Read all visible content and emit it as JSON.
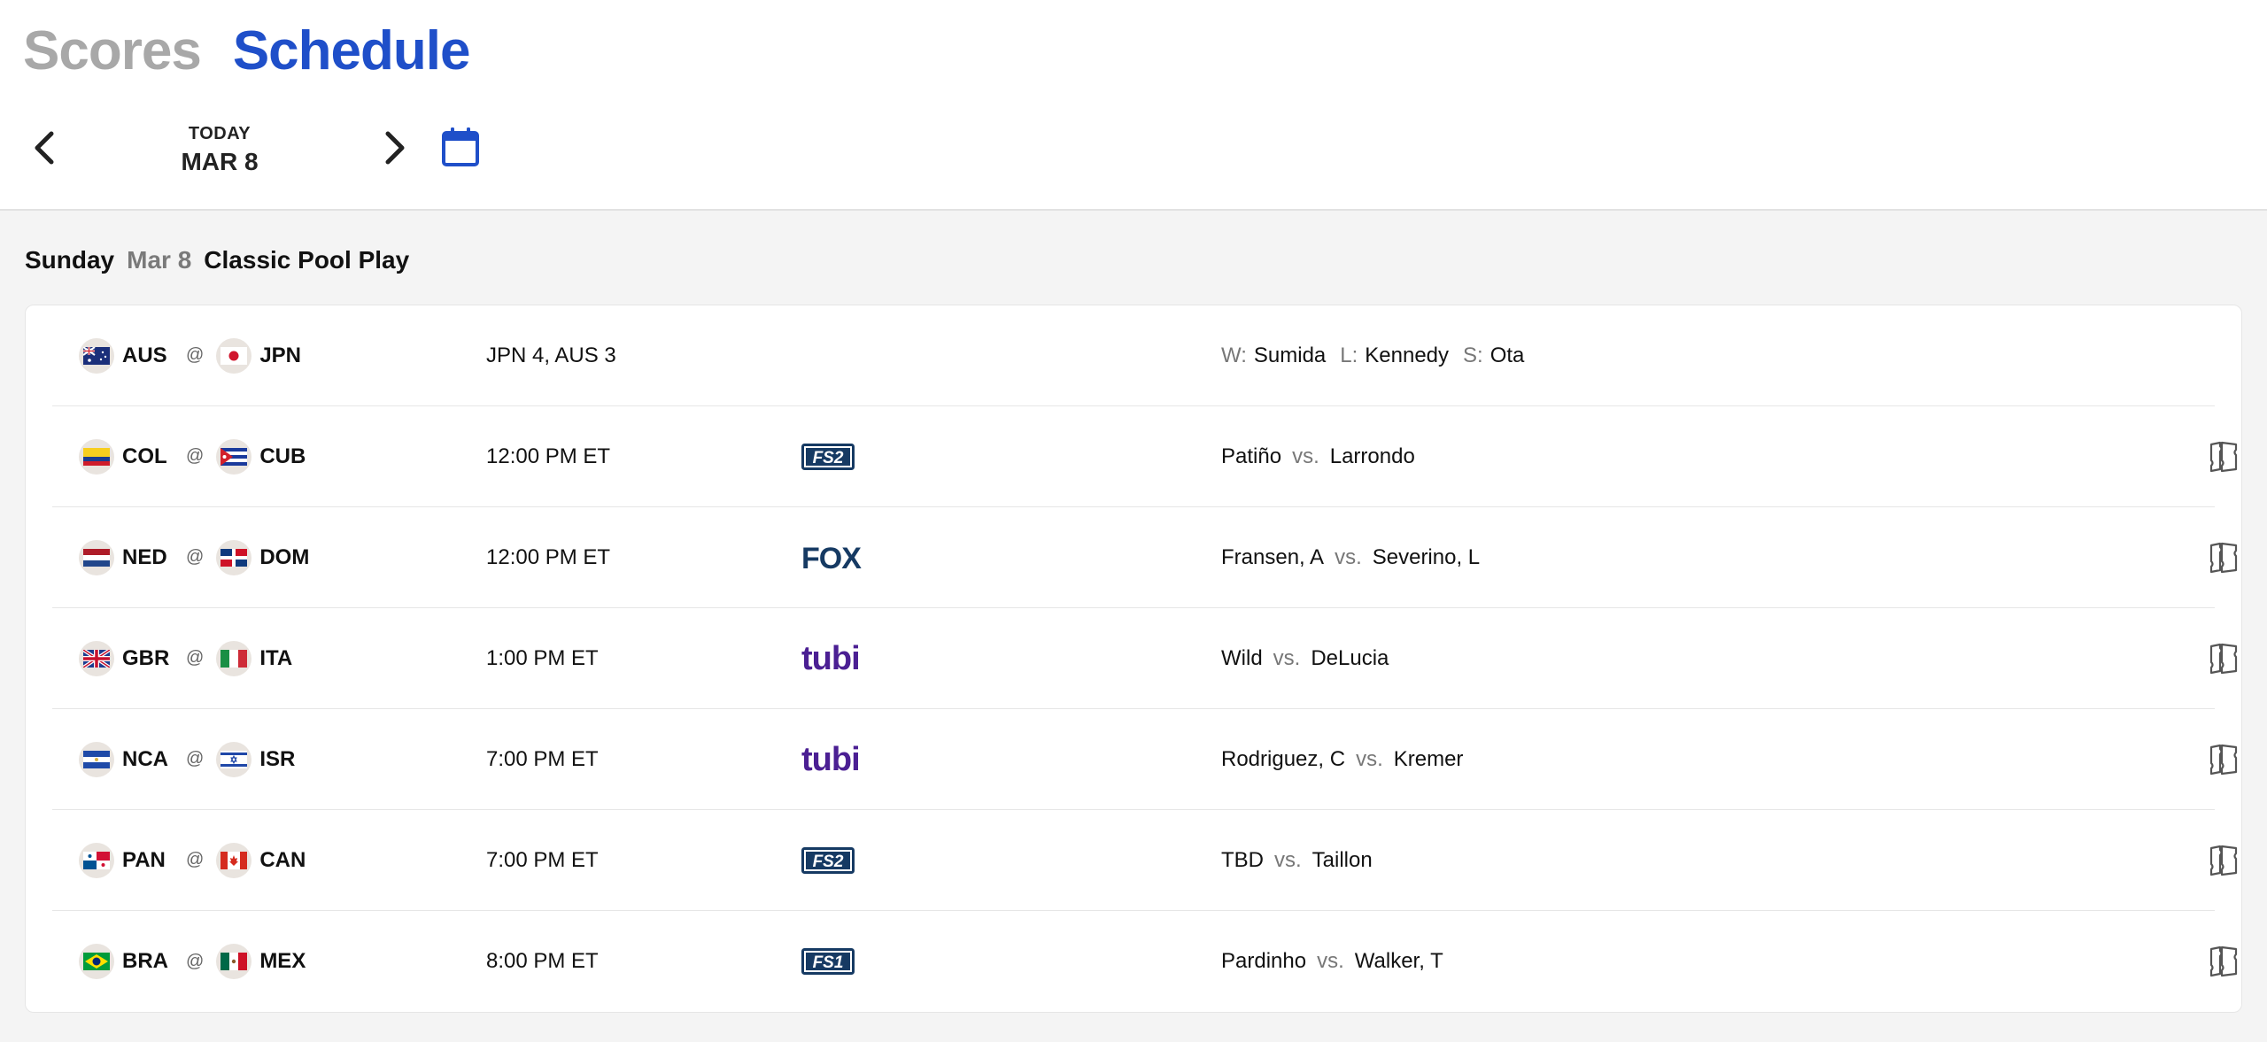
{
  "tabs": {
    "scores": "Scores",
    "schedule": "Schedule"
  },
  "date_nav": {
    "today_label": "TODAY",
    "date": "MAR 8"
  },
  "day_header": {
    "weekday": "Sunday",
    "date": "Mar 8",
    "round": "Classic Pool Play"
  },
  "games": [
    {
      "away": "AUS",
      "home": "JPN",
      "at": "@",
      "status": "JPN 4, AUS 3",
      "network": "",
      "pitchers_type": "result",
      "w_label": "W:",
      "w": "Sumida",
      "l_label": "L:",
      "l": "Kennedy",
      "s_label": "S:",
      "s": "Ota",
      "ticket": false
    },
    {
      "away": "COL",
      "home": "CUB",
      "at": "@",
      "status": "12:00 PM ET",
      "network": "FS2",
      "pitchers_type": "probable",
      "away_pitcher": "Patiño",
      "vs": "vs.",
      "home_pitcher": "Larrondo",
      "ticket": true
    },
    {
      "away": "NED",
      "home": "DOM",
      "at": "@",
      "status": "12:00 PM ET",
      "network": "FOX",
      "pitchers_type": "probable",
      "away_pitcher": "Fransen, A",
      "vs": "vs.",
      "home_pitcher": "Severino, L",
      "ticket": true
    },
    {
      "away": "GBR",
      "home": "ITA",
      "at": "@",
      "status": "1:00 PM ET",
      "network": "tubi",
      "pitchers_type": "probable",
      "away_pitcher": "Wild",
      "vs": "vs.",
      "home_pitcher": "DeLucia",
      "ticket": true
    },
    {
      "away": "NCA",
      "home": "ISR",
      "at": "@",
      "status": "7:00 PM ET",
      "network": "tubi",
      "pitchers_type": "probable",
      "away_pitcher": "Rodriguez, C",
      "vs": "vs.",
      "home_pitcher": "Kremer",
      "ticket": true
    },
    {
      "away": "PAN",
      "home": "CAN",
      "at": "@",
      "status": "7:00 PM ET",
      "network": "FS2",
      "pitchers_type": "probable",
      "away_pitcher": "TBD",
      "vs": "vs.",
      "home_pitcher": "Taillon",
      "ticket": true
    },
    {
      "away": "BRA",
      "home": "MEX",
      "at": "@",
      "status": "8:00 PM ET",
      "network": "FS1",
      "pitchers_type": "probable",
      "away_pitcher": "Pardinho",
      "vs": "vs.",
      "home_pitcher": "Walker, T",
      "ticket": true
    }
  ],
  "colors": {
    "accent": "#1f4fc9",
    "fox_navy": "#163a63",
    "tubi_purple": "#4b1f93",
    "muted": "#777777"
  }
}
